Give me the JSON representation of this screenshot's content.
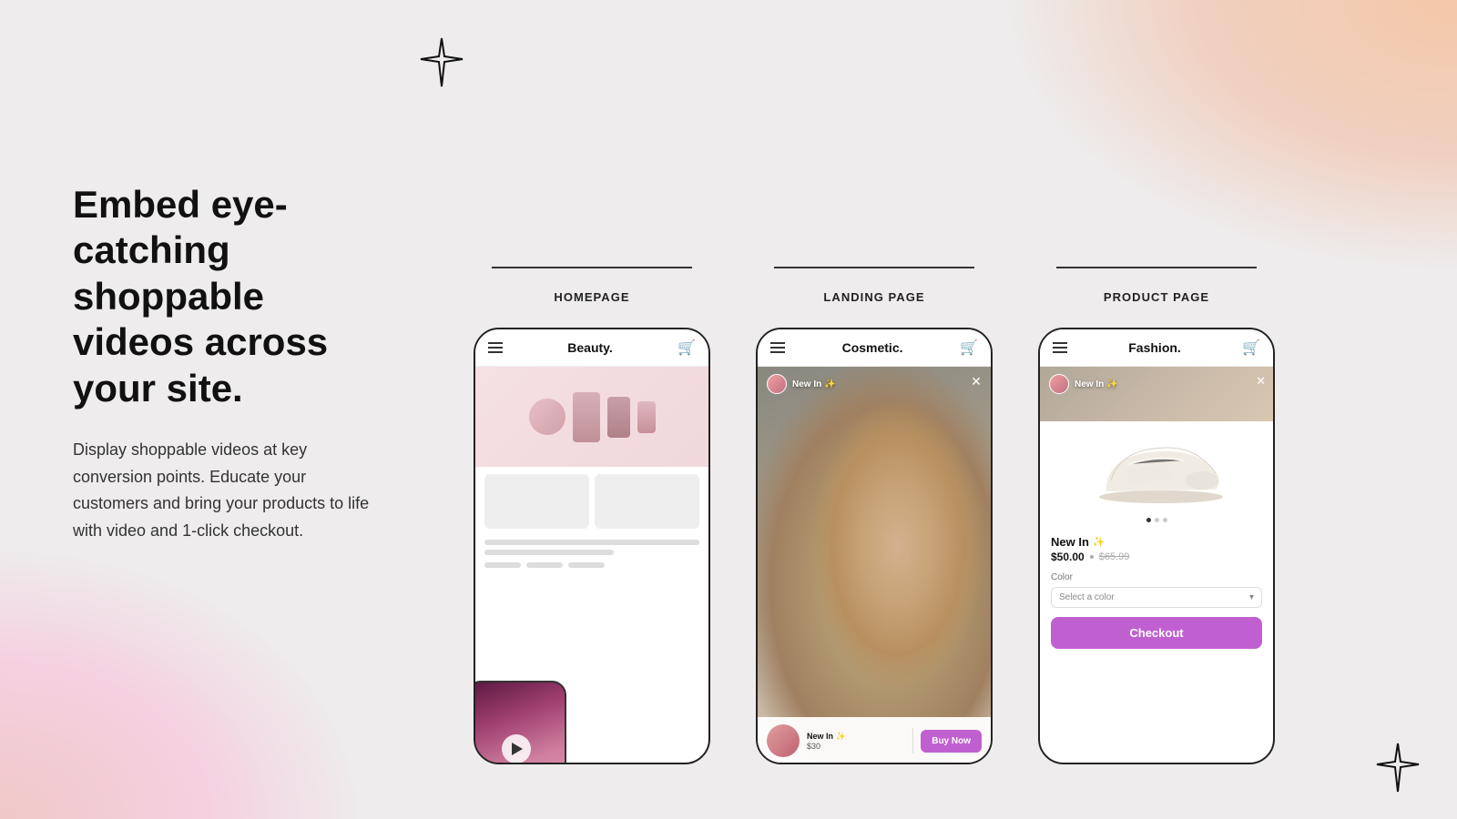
{
  "page": {
    "bg_gradient_top": "radial-gradient top-right peach",
    "bg_gradient_bottom": "radial-gradient bottom-left pink"
  },
  "left": {
    "heading": "Embed eye-catching shoppable videos across your site.",
    "subtext": "Display shoppable videos at key conversion points. Educate your customers and bring your products to life with video and 1-click checkout."
  },
  "phones": {
    "homepage": {
      "label": "HOMEPAGE",
      "topbar_title": "Beauty.",
      "video_overlay_visible": true
    },
    "landing": {
      "label": "LANDING PAGE",
      "topbar_title": "Cosmetic.",
      "story_label": "New In",
      "sparkle": "✨",
      "product_name": "New In ✨",
      "product_price": "$30",
      "buy_button": "Buy Now"
    },
    "product": {
      "label": "PRODUCT PAGE",
      "topbar_title": "Fashion.",
      "story_label": "New In",
      "sparkle": "✨",
      "badge_label": "New",
      "product_title": "New In",
      "product_price": "$50.00",
      "product_original": "$65.99",
      "color_label": "Color",
      "color_placeholder": "Select a color",
      "checkout_button": "Checkout"
    }
  }
}
